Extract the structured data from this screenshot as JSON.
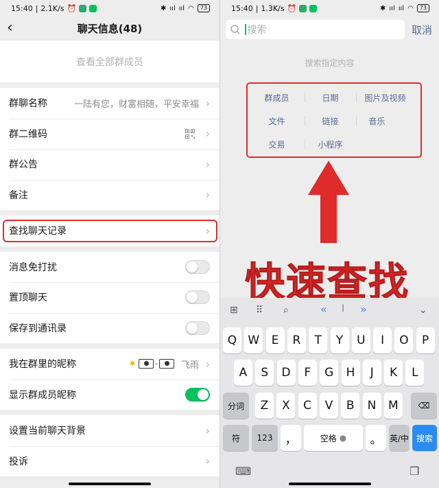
{
  "left": {
    "status": {
      "time": "15:40",
      "speed": "2.1K/s",
      "signal": "ııl",
      "battery": "73"
    },
    "header": {
      "title": "聊天信息(48)",
      "back_icon": "chevron-left-icon"
    },
    "members_text": "查看全部群成员",
    "rows_group1": [
      {
        "label": "群聊名称",
        "value": "一陆有您，财富相随，平安幸福"
      },
      {
        "label": "群二维码",
        "value": ""
      },
      {
        "label": "群公告",
        "value": ""
      },
      {
        "label": "备注",
        "value": ""
      }
    ],
    "search_history": {
      "label": "查找聊天记录"
    },
    "toggles": [
      {
        "label": "消息免打扰",
        "on": false
      },
      {
        "label": "置顶聊天",
        "on": false
      },
      {
        "label": "保存到通讯录",
        "on": false
      }
    ],
    "nickname": {
      "label": "我在群里的昵称",
      "dash": "-",
      "name": "飞雨"
    },
    "show_nick": {
      "label": "显示群成员昵称",
      "on": true
    },
    "rows_group5": [
      {
        "label": "设置当前聊天背景"
      },
      {
        "label": "投诉"
      }
    ],
    "highlight_color": "#e02b2b",
    "toggle_on_color": "#07c160"
  },
  "right": {
    "status": {
      "time": "15:40",
      "speed": "1.3K/s",
      "signal": "ııl",
      "battery": "73"
    },
    "search": {
      "placeholder": "搜索",
      "cancel": "取消"
    },
    "hint": "搜索指定内容",
    "categories": [
      "群成员",
      "日期",
      "图片及视频",
      "文件",
      "链接",
      "音乐",
      "交易",
      "小程序"
    ],
    "overlay_text": "快速查找",
    "link_color": "#576b95",
    "keyboard": {
      "toolbar": {
        "left_arrows": "«",
        "cursor": "I",
        "right_arrows": "»"
      },
      "row1": [
        "Q",
        "W",
        "E",
        "R",
        "T",
        "Y",
        "U",
        "I",
        "O",
        "P"
      ],
      "row2": [
        "A",
        "S",
        "D",
        "F",
        "G",
        "H",
        "J",
        "K",
        "L"
      ],
      "row3": [
        "Z",
        "X",
        "C",
        "V",
        "B",
        "N",
        "M"
      ],
      "row3_left": "分词",
      "row4": {
        "symbol": "符",
        "num": "123",
        "comma": "，",
        "space": "空格",
        "period": "。",
        "lang": "英/中",
        "search": "搜索"
      }
    }
  }
}
